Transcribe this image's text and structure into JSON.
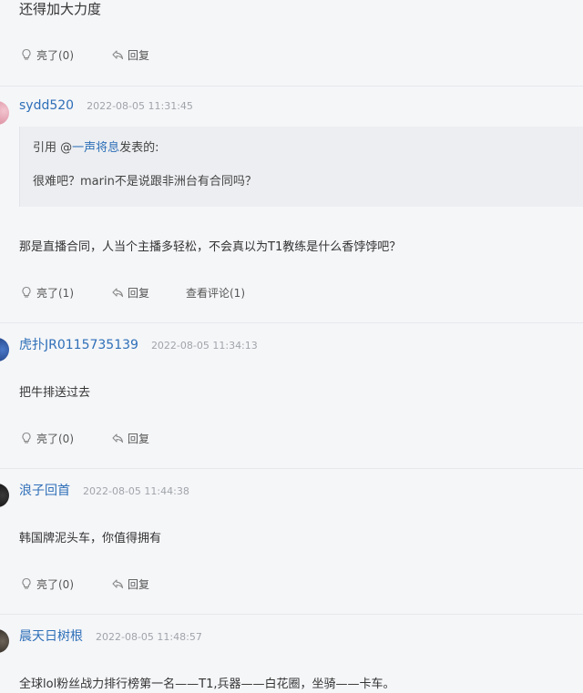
{
  "top_fragment": "还得加大力度",
  "labels": {
    "reply": "回复"
  },
  "posts": [
    {
      "like_label": "亮了(0)"
    },
    {
      "username": "sydd520",
      "time": "2022-08-05 11:31:45",
      "quote_prefix": "引用 @",
      "quote_user": "一声将息",
      "quote_suffix": "发表的:",
      "quote_text": "很难吧？marin不是说跟非洲台有合同吗？",
      "text": "那是直播合同，人当个主播多轻松，不会真以为T1教练是什么香饽饽吧？",
      "like_label": "亮了(1)",
      "view_label": "查看评论(1)"
    },
    {
      "username": "虎扑JR0115735139",
      "time": "2022-08-05 11:34:13",
      "text": "把牛排送过去",
      "like_label": "亮了(0)"
    },
    {
      "username": "浪子回首",
      "time": "2022-08-05 11:44:38",
      "text": "韩国牌泥头车，你值得拥有",
      "like_label": "亮了(0)"
    },
    {
      "username": "晨天日树根",
      "time": "2022-08-05 11:48:57",
      "text": "全球lol粉丝战力排行榜第一名——T1,兵器——白花圈，坐骑——卡车。"
    }
  ],
  "colors": {
    "background": "#f5f6f8",
    "username": "#2e6fb8",
    "timestamp": "#a0a4aa",
    "quote_bg": "#eceef1",
    "divider": "#e6e8ec"
  },
  "icons": {
    "like": "light-bulb-icon",
    "reply": "reply-arrow-icon"
  }
}
